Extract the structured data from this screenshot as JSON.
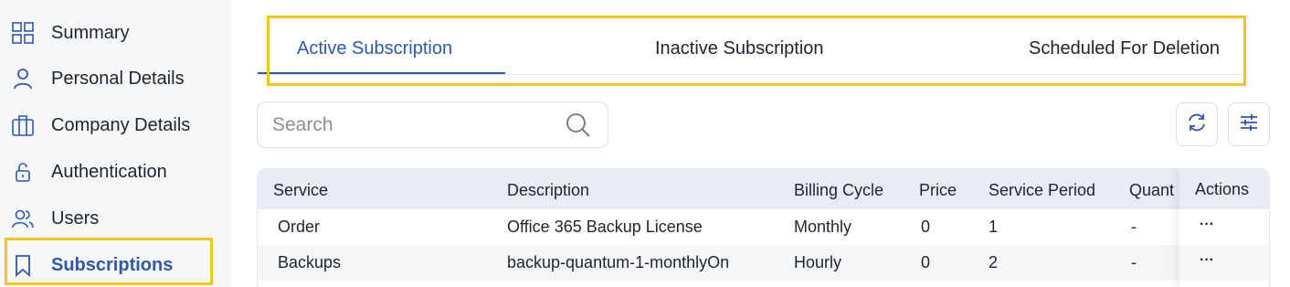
{
  "sidebar": {
    "items": [
      {
        "label": "Summary",
        "icon": "grid-icon"
      },
      {
        "label": "Personal Details",
        "icon": "user-icon"
      },
      {
        "label": "Company Details",
        "icon": "building-icon"
      },
      {
        "label": "Authentication",
        "icon": "lock-icon"
      },
      {
        "label": "Users",
        "icon": "users-icon"
      },
      {
        "label": "Subscriptions",
        "icon": "bookmark-icon",
        "active": true
      }
    ]
  },
  "tabs": [
    {
      "label": "Active Subscription",
      "active": true
    },
    {
      "label": "Inactive Subscription"
    },
    {
      "label": "Scheduled For Deletion"
    }
  ],
  "search": {
    "placeholder": "Search",
    "value": ""
  },
  "toolbar": {
    "refresh_icon": "refresh-icon",
    "filter_icon": "sliders-icon"
  },
  "table": {
    "columns": [
      "Service",
      "Description",
      "Billing Cycle",
      "Price",
      "Service Period",
      "Quant",
      "Actions"
    ],
    "rows": [
      {
        "service": "Order",
        "description": "Office 365 Backup License",
        "billing_cycle": "Monthly",
        "price": "0",
        "service_period": "1",
        "quantity": "-",
        "actions": "···"
      },
      {
        "service": "Backups",
        "description": "backup-quantum-1-monthlyOn",
        "billing_cycle": "Hourly",
        "price": "0",
        "service_period": "2",
        "quantity": "-",
        "actions": "···"
      }
    ]
  },
  "colors": {
    "accent": "#2f56b0",
    "highlight": "#f5c518",
    "header_bg": "#e8ecf4"
  }
}
